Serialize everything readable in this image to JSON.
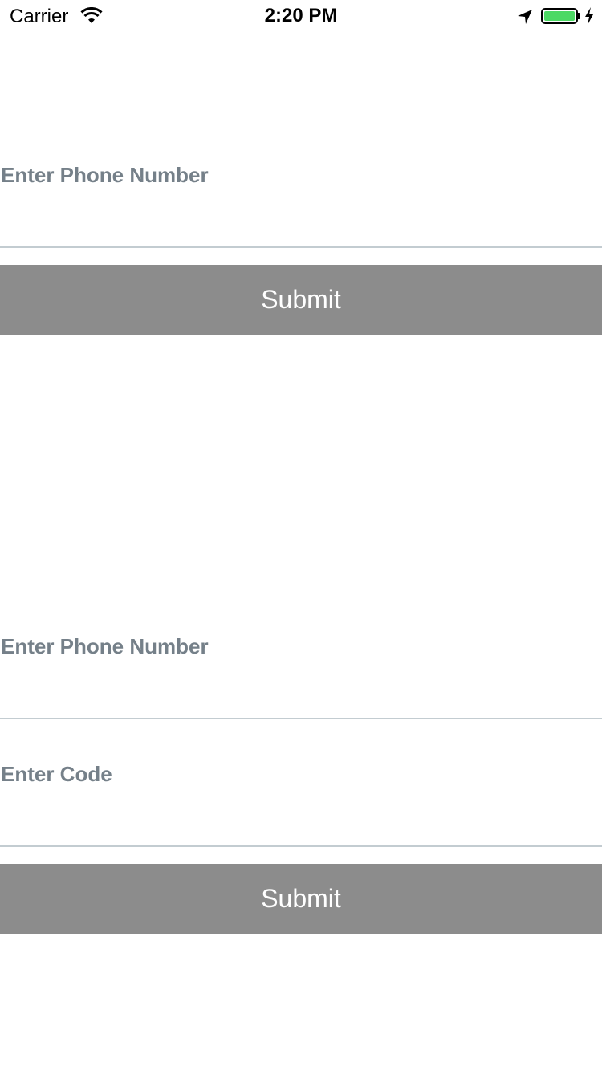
{
  "status_bar": {
    "carrier": "Carrier",
    "time": "2:20 PM",
    "icons": [
      "wifi-icon",
      "location-arrow-icon",
      "battery-icon",
      "charging-bolt-icon"
    ],
    "battery_color": "#4cd964"
  },
  "form_top": {
    "phone_placeholder": "Enter Phone Number",
    "submit_label": "Submit"
  },
  "form_bottom": {
    "phone_placeholder": "Enter Phone Number",
    "code_placeholder": "Enter Code",
    "submit_label": "Submit"
  },
  "colors": {
    "placeholder": "#758089",
    "underline": "#c3ccd1",
    "button_bg": "#8c8c8c",
    "button_text": "#ffffff"
  }
}
